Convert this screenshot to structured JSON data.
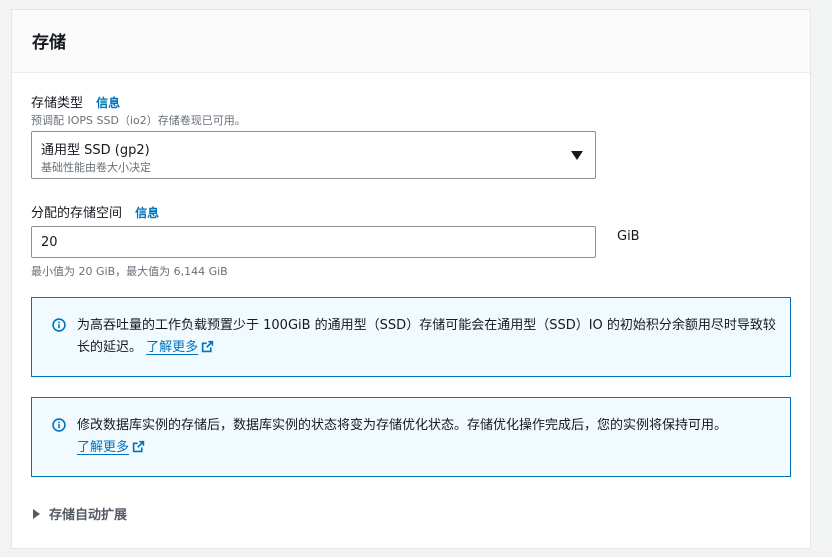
{
  "panel": {
    "title": "存储"
  },
  "storage_type": {
    "label": "存储类型",
    "info": "信息",
    "description": "预调配 IOPS SSD（io2）存储卷现已可用。",
    "selected": "通用型 SSD (gp2)",
    "selected_description": "基础性能由卷大小决定"
  },
  "allocated_storage": {
    "label": "分配的存储空间",
    "info": "信息",
    "value": "20",
    "unit": "GiB",
    "constraint": "最小值为 20 GiB，最大值为 6,144 GiB"
  },
  "alerts": [
    {
      "text": "为高吞吐量的工作负载预置少于 100GiB 的通用型（SSD）存储可能会在通用型（SSD）IO 的初始积分余额用尽时导致较长的延迟。",
      "link": "了解更多"
    },
    {
      "text": "修改数据库实例的存储后，数据库实例的状态将变为存储优化状态。存储优化操作完成后，您的实例将保持可用。",
      "link": "了解更多"
    }
  ],
  "autoscaling": {
    "label": "存储自动扩展"
  },
  "colors": {
    "accent": "#0073bb",
    "alert_bg": "#f1faff",
    "text": "#16191f",
    "muted": "#687078"
  }
}
